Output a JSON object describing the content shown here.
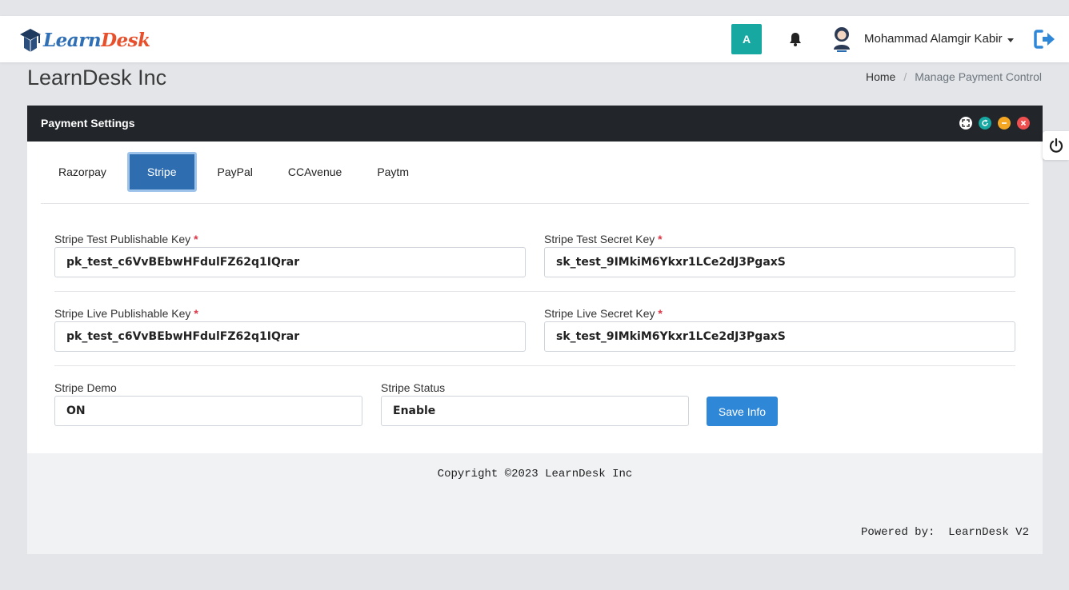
{
  "brand": {
    "logo_part1": "Learn",
    "logo_part2": "Desk"
  },
  "navbar": {
    "lang_label": "A",
    "user_name": "Mohammad Alamgir Kabir"
  },
  "page": {
    "title": "LearnDesk Inc",
    "breadcrumb": {
      "home": "Home",
      "separator": "/",
      "current": "Manage Payment Control"
    }
  },
  "card": {
    "title": "Payment Settings",
    "tabs": [
      {
        "label": "Razorpay",
        "active": false
      },
      {
        "label": "Stripe",
        "active": true
      },
      {
        "label": "PayPal",
        "active": false
      },
      {
        "label": "CCAvenue",
        "active": false
      },
      {
        "label": "Paytm",
        "active": false
      }
    ],
    "fields": {
      "test_publishable": {
        "label": "Stripe Test Publishable Key",
        "required": "*",
        "value": "pk_test_c6VvBEbwHFdulFZ62q1IQrar"
      },
      "test_secret": {
        "label": "Stripe Test Secret Key",
        "required": "*",
        "value": "sk_test_9IMkiM6Ykxr1LCe2dJ3PgaxS"
      },
      "live_publishable": {
        "label": "Stripe Live Publishable Key",
        "required": "*",
        "value": "pk_test_c6VvBEbwHFdulFZ62q1IQrar"
      },
      "live_secret": {
        "label": "Stripe Live Secret Key",
        "required": "*",
        "value": "sk_test_9IMkiM6Ykxr1LCe2dJ3PgaxS"
      },
      "demo": {
        "label": "Stripe Demo",
        "value": "ON"
      },
      "status": {
        "label": "Stripe Status",
        "value": "Enable"
      }
    },
    "save_label": "Save Info"
  },
  "footer": {
    "copyright": "Copyright ©2023 LearnDesk Inc",
    "powered": "Powered by:  LearnDesk V2"
  },
  "colors": {
    "accent_blue": "#2e6db0",
    "save_blue": "#2f87d8",
    "teal": "#17a8a2",
    "header_dark": "#22252a",
    "required_red": "#dc3545"
  }
}
